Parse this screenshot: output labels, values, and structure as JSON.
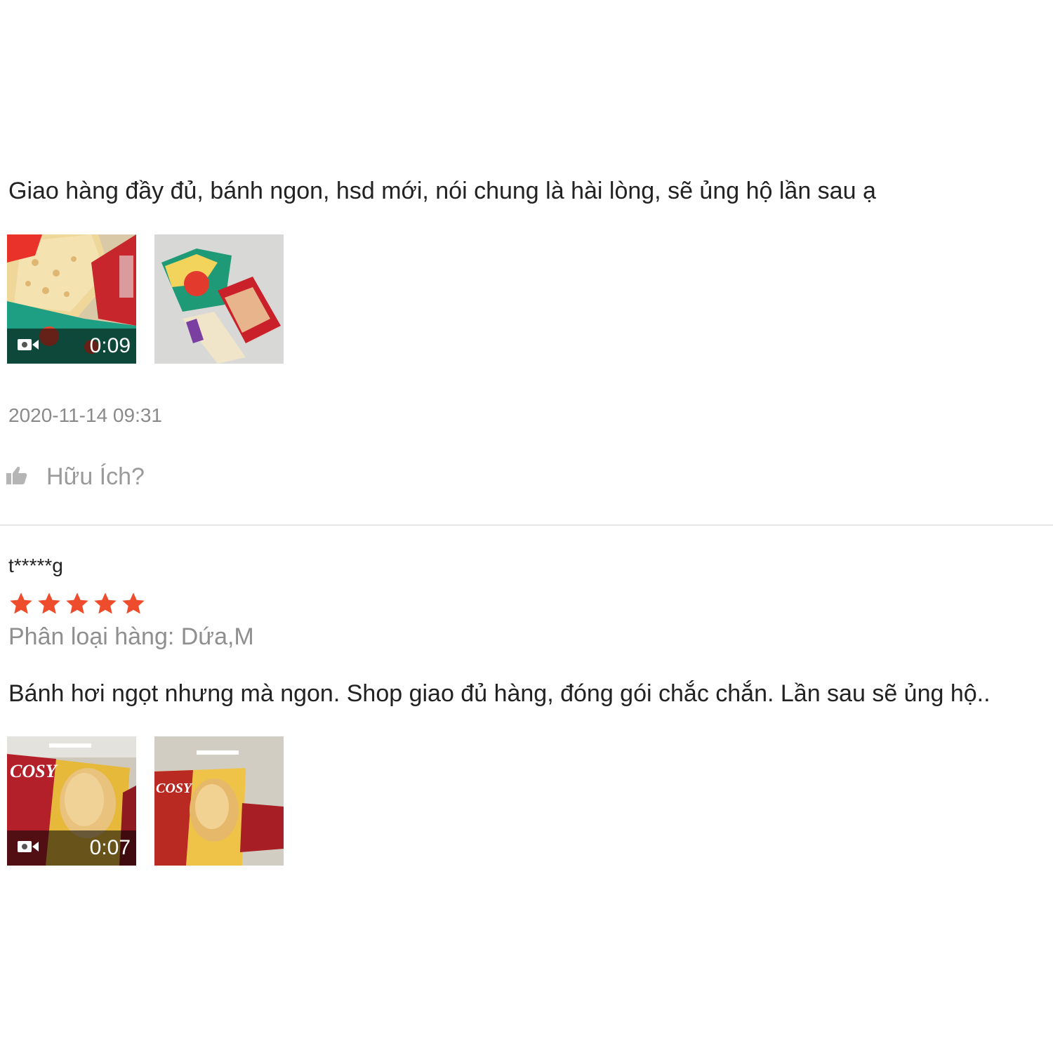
{
  "review1": {
    "comment": "Giao hàng đầy đủ, bánh ngon, hsd mới, nói chung là hài lòng, sẽ ủng hộ lần sau ạ",
    "video_duration": "0:09",
    "timestamp": "2020-11-14 09:31",
    "helpful_label": "Hữu Ích?"
  },
  "review2": {
    "username": "t*****g",
    "rating": 5,
    "star_color": "#ee4d2d",
    "variant": "Phân loại hàng: Dứa,M",
    "comment": "Bánh hơi ngọt nhưng mà ngon. Shop giao đủ hàng, đóng gói chắc chắn. Lần sau sẽ ủng hộ..",
    "video_duration": "0:07"
  },
  "icons": {
    "video": "video-camera-icon",
    "helpful": "thumbs-up-icon",
    "star": "star-icon"
  }
}
